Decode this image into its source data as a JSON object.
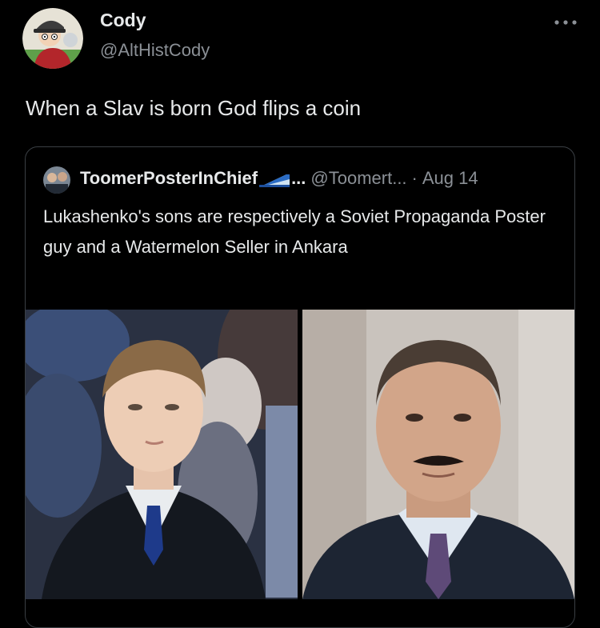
{
  "tweet": {
    "author": {
      "display_name": "Cody",
      "handle": "@AltHistCody",
      "avatar": "cartoon-avatar"
    },
    "more_icon": "more-dots-icon",
    "text": "When a Slav is born God flips a coin"
  },
  "quoted_tweet": {
    "author": {
      "display_name": "ToomerPosterInChief",
      "flag_icon": "flag-emoji-icon",
      "ellipsis": "...",
      "handle": "@Toomert...",
      "separator": "·",
      "date": "Aug 14"
    },
    "text": "Lukashenko's sons are respectively a Soviet Propaganda Poster guy and a Watermelon Seller in Ankara",
    "images": [
      {
        "description": "young man in dark coat with blue tie"
      },
      {
        "description": "man with mustache in suit and purple tie"
      }
    ]
  },
  "colors": {
    "background": "#000000",
    "primary_text": "#e7e9ea",
    "secondary_text": "#8b9096",
    "card_border": "#3a3f44"
  }
}
